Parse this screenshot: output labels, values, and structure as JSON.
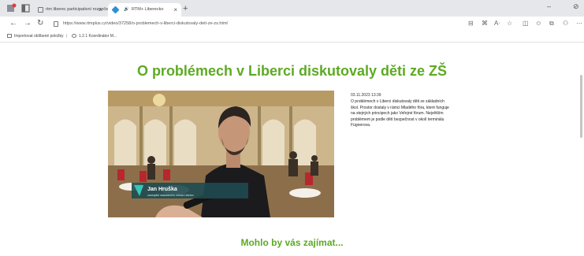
{
  "browser": {
    "tabs": [
      {
        "title": "rtm liberec participativní rozpočet",
        "active": false
      },
      {
        "title": "RTM+ Liberecko",
        "active": true
      }
    ],
    "url": "https://www.rtmplus.cz/video/37258/o-problemech-v-liberci-diskutovaly-deti-ze-zs.html",
    "bookmarks": [
      "Importovat oblíbené položky",
      "1.2.1 Koordinátor M..."
    ]
  },
  "article": {
    "title": "O problémech v Liberci diskutovaly děti ze ZŠ",
    "date": "03.11.2023 13:39",
    "body": "O problémech v Liberci diskutovaly děti ze základních škol. Prostor dostaly v rámci Mladého fóra, které funguje na stejných principech jako Veřejné fórum. Největším problémem je podle dětí bezpečnost v okolí terminálu Fügnerova.",
    "caption_name": "Jan Hruška",
    "caption_role": "zastupitel statutárního města Liberec"
  },
  "more_heading": "Mohlo by vás zajímat...",
  "colors": {
    "accent": "#5daa24",
    "caption_bar": "#1e4a50"
  }
}
